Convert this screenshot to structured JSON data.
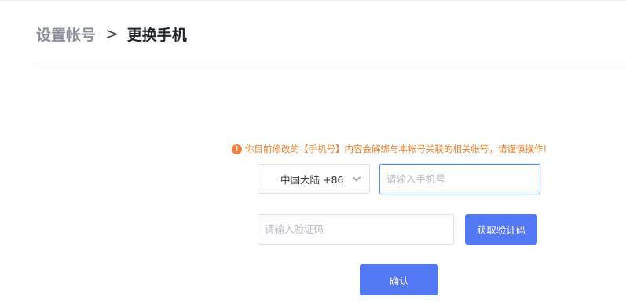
{
  "breadcrumb": {
    "parent": "设置帐号",
    "separator": ">",
    "current": "更换手机"
  },
  "warning": {
    "icon": "!",
    "text": "你目前修改的【手机号】内容会解绑与本帐号关联的相关帐号，请谨慎操作!"
  },
  "form": {
    "region": {
      "value": "中国大陆 +86",
      "icon": "chevron-down-icon"
    },
    "phone": {
      "value": "",
      "placeholder": "请输入手机号"
    },
    "code": {
      "value": "",
      "placeholder": "请输入验证码"
    },
    "get_code_label": "获取验证码",
    "confirm_label": "确认"
  },
  "colors": {
    "primary": "#5278f6",
    "warning": "#f0812e",
    "focus_border": "#4e8cf5"
  }
}
